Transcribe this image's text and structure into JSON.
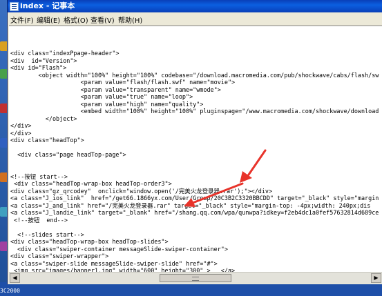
{
  "window": {
    "title": "index - 记事本",
    "accent_color": "#0b5fe0"
  },
  "menu": [
    "文件(F)",
    "编辑(E)",
    "格式(O)",
    "查看(V)",
    "帮助(H)"
  ],
  "taskbar_text": "3C2000",
  "code_lines": [
    "<div class=\"indexPpage-header\">",
    "<div  id=\"Version\">",
    "<div id=\"Flash\">",
    "        <object width=\"100%\" height=\"100%\" codebase=\"/download.macromedia.com/pub/shockwave/cabs/flash/sw",
    "                    <param value=\"flash/flash.swf\" name=\"movie\">",
    "                    <param value=\"transparent\" name=\"wmode\">",
    "                    <param value=\"true\" name=\"loop\">",
    "                    <param value=\"high\" name=\"quality\">",
    "                    <embed width=\"100%\" height=\"100%\" pluginspage=\"/www.macromedia.com/shockwave/download",
    "          </object>",
    "</div>",
    "</div>",
    "<div class=\"headTop\">",
    "",
    "  <div class=\"page headTop-page\">",
    "",
    "",
    "<!--按钮 start-->",
    " <div class=\"headTop-wrap-box headTop-order3\">",
    "<div class=\"gz_qrcodey\"  onclick=\"window.open('/完美火龙登录器.rar');\"></div>",
    "<a class=\"J_ios_link\"  href=\"/get66.1866yx.com/User/Group/20C3B2C3320BBCDD\" target=\"_black\" style=\"margin",
    "<a class=\"J_and_link\" href=\"/完美火龙登录器.rar\" target=\"_black\" style=\"margin-top: -4px;width: 240px;dis",
    "<a class=\"J_landie_link\" target=\"_blank\" href=\"/shang.qq.com/wpa/qunwpa?idkey=f2eb4dc1a0fef57632814d689ce",
    " <!--按钮  end-->",
    "",
    "  <!--slides start-->",
    "<div class=\"headTop-wrap-box headTop-slides\">",
    "  <div class=\"swiper-container messageSlide-swiper-container\">",
    "<div class=\"swiper-wrapper\">",
    "<a class=\"swiper-slide messageSlide-swiper-slide\" href=\"#\">",
    " <img src=\"images/banner1.jpg\" width=\"600\" height=\"300\" >   </a>"
  ],
  "scrollbar": {
    "left_arrow_icon": "chevron-left-icon",
    "right_arrow_icon": "chevron-right-icon"
  },
  "annotation_color": "#e8332a"
}
